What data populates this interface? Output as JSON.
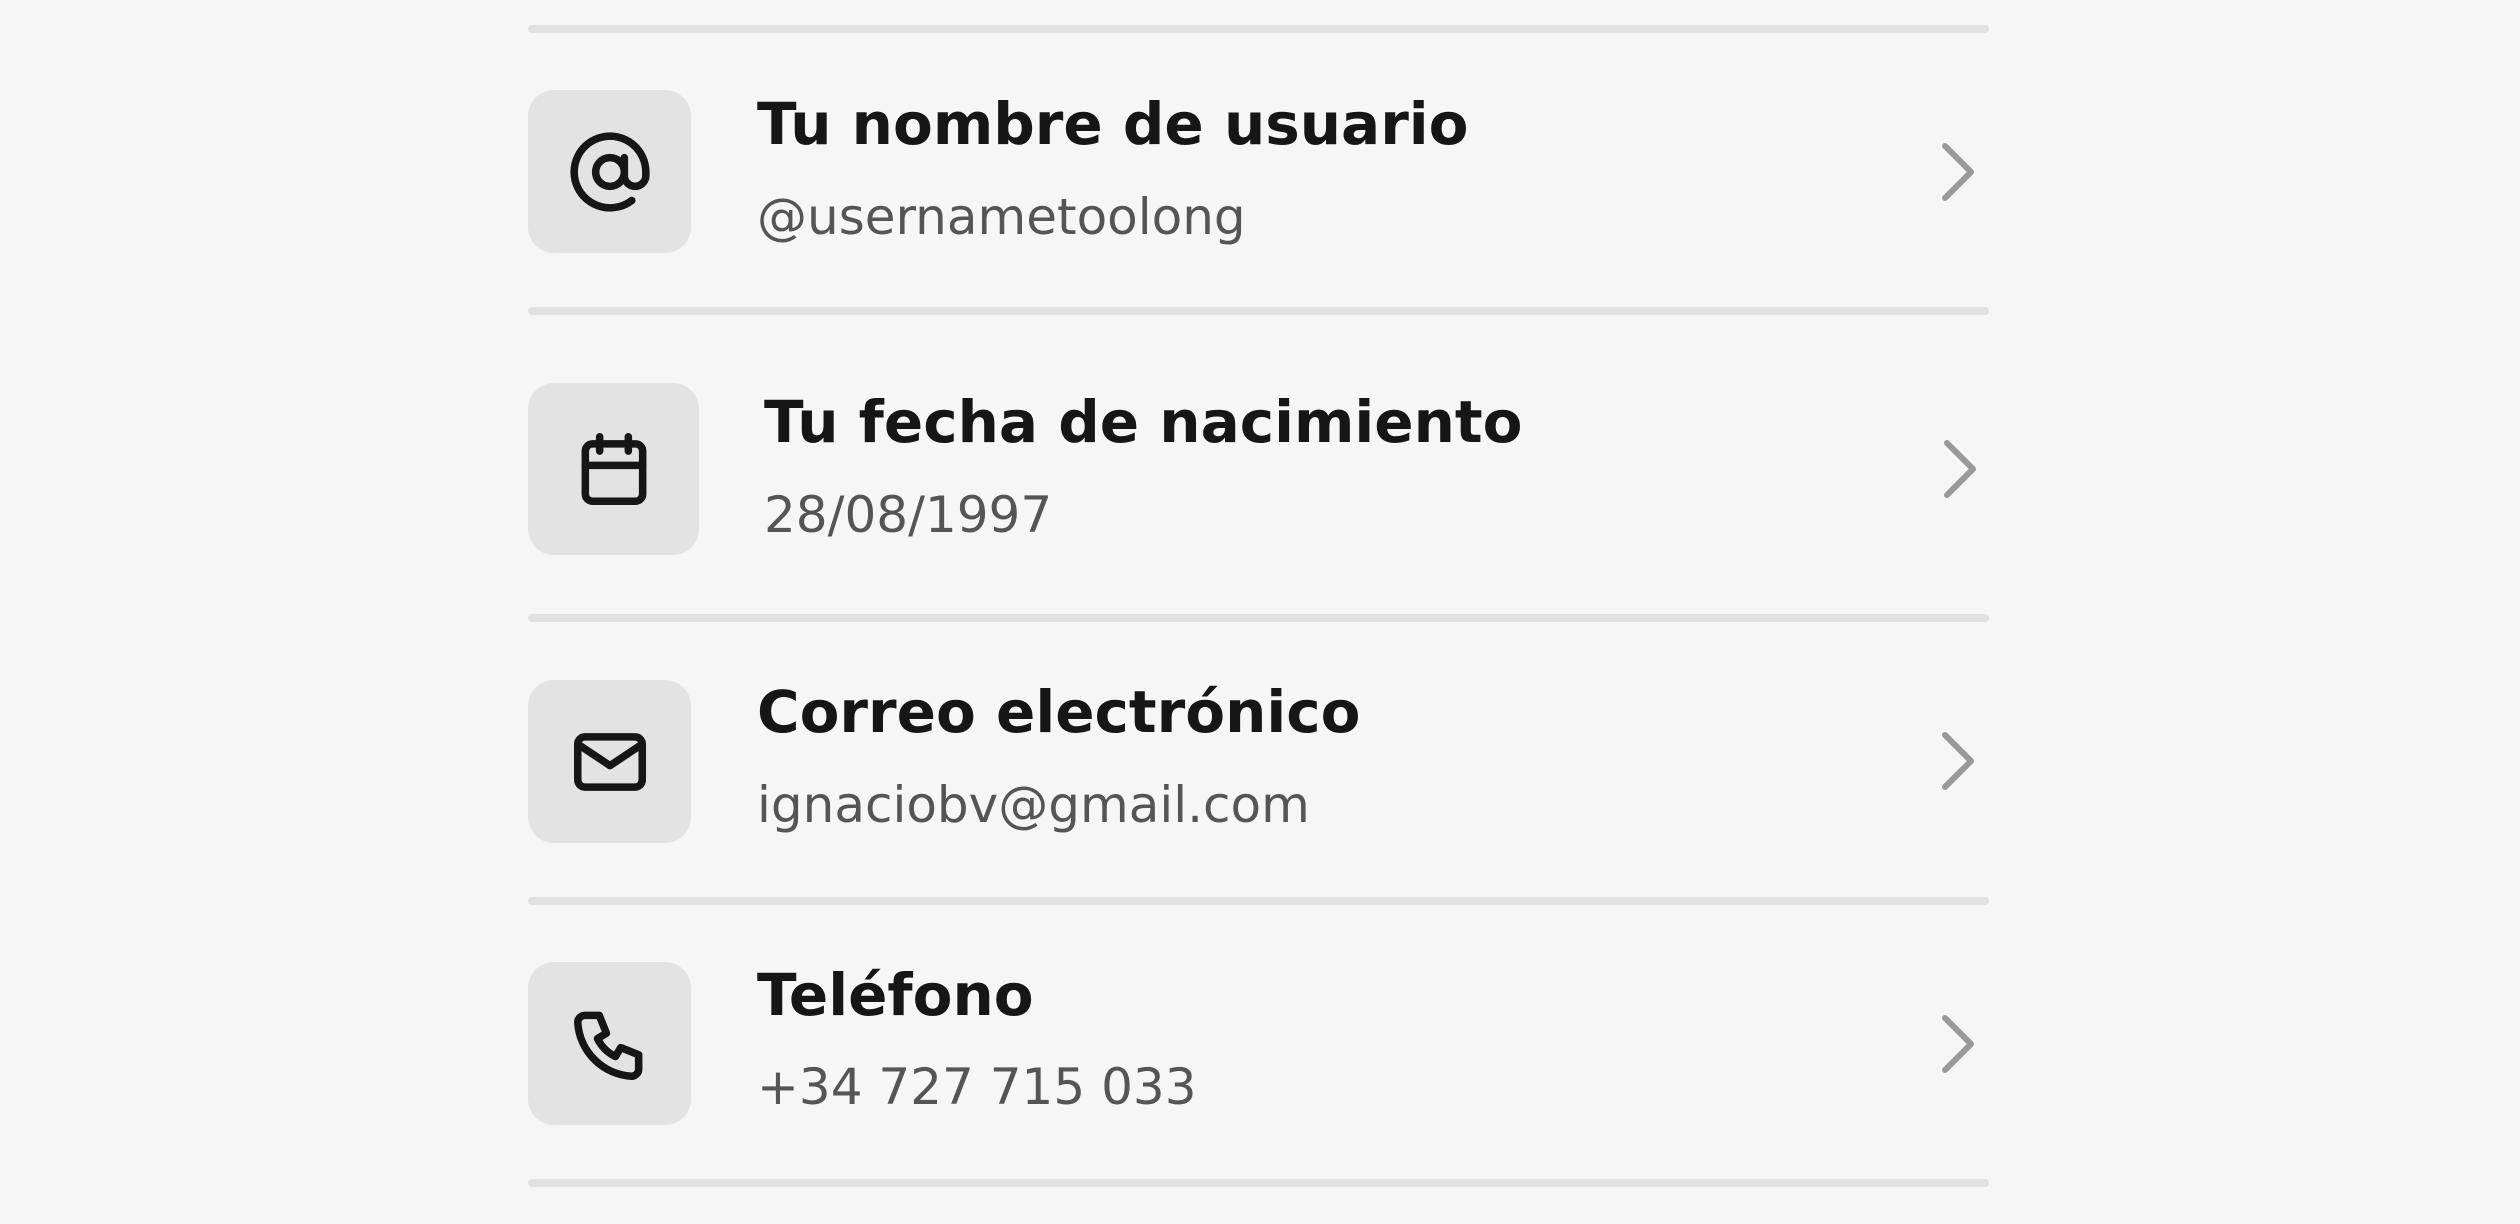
{
  "items": [
    {
      "title": "Tu nombre de usuario",
      "value": "@usernametoolong",
      "icon": "at-sign-icon"
    },
    {
      "title": "Tu fecha de nacimiento",
      "value": "28/08/1997",
      "icon": "calendar-icon"
    },
    {
      "title": "Correo electrónico",
      "value": "ignaciobv@gmail.com",
      "icon": "mail-icon"
    },
    {
      "title": "Teléfono",
      "value": "+34 727 715 033",
      "icon": "phone-icon"
    }
  ],
  "colors": {
    "background": "#f6f6f6",
    "divider": "#e1e1e1",
    "icon_box": "#e3e3e3",
    "title": "#161616",
    "value": "#555555",
    "chevron": "#999999"
  }
}
